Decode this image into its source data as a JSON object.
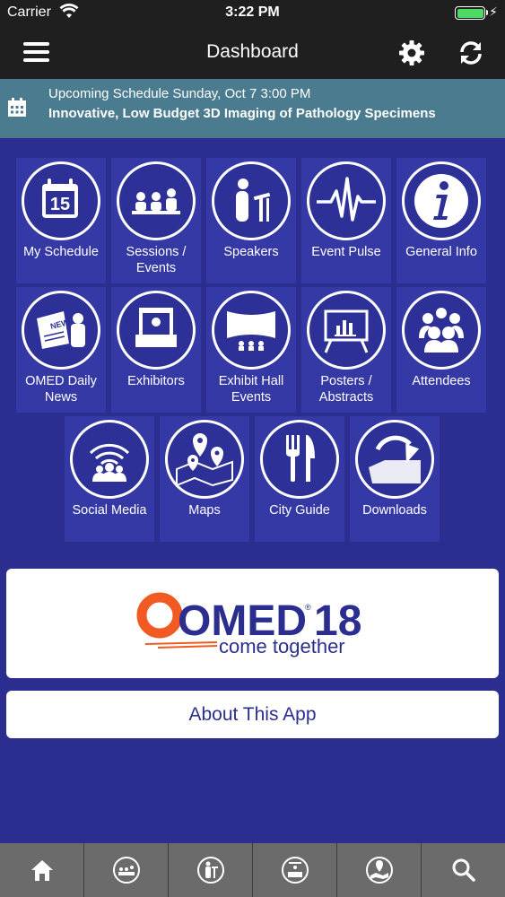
{
  "status_bar": {
    "carrier": "Carrier",
    "time": "3:22 PM",
    "battery_color": "#4cd964"
  },
  "navbar": {
    "title": "Dashboard",
    "left_icon": "hamburger-menu-icon",
    "right_icons": [
      "gear-icon",
      "refresh-icon"
    ]
  },
  "banner": {
    "icon": "calendar-icon",
    "line1": "Upcoming Schedule Sunday, Oct 7 3:00 PM",
    "line2": "Innovative, Low Budget 3D Imaging of Pathology Specimens"
  },
  "tiles": [
    {
      "label": "My Schedule",
      "icon": "calendar-15-icon"
    },
    {
      "label": "Sessions / Events",
      "icon": "audience-icon"
    },
    {
      "label": "Speakers",
      "icon": "speaker-podium-icon"
    },
    {
      "label": "Event Pulse",
      "icon": "pulse-icon"
    },
    {
      "label": "General Info",
      "icon": "info-icon"
    },
    {
      "label": "OMED Daily News",
      "icon": "newspaper-icon"
    },
    {
      "label": "Exhibitors",
      "icon": "exhibitor-booth-icon"
    },
    {
      "label": "Exhibit Hall Events",
      "icon": "exhibit-hall-icon"
    },
    {
      "label": "Posters / Abstracts",
      "icon": "poster-board-icon"
    },
    {
      "label": "Attendees",
      "icon": "attendees-icon"
    },
    {
      "label": "Social Media",
      "icon": "social-broadcast-icon"
    },
    {
      "label": "Maps",
      "icon": "map-pins-icon"
    },
    {
      "label": "City Guide",
      "icon": "fork-knife-icon"
    },
    {
      "label": "Downloads",
      "icon": "download-icon"
    }
  ],
  "logo": {
    "brand": "OMED",
    "year": "18",
    "tagline": "come together",
    "brand_color": "#2b2e8f",
    "accent_color": "#f15a22"
  },
  "about_button": "About This App",
  "tabbar": {
    "tabs": [
      "home-icon",
      "sessions-icon",
      "speakers-icon",
      "exhibitors-icon",
      "maps-icon",
      "search-icon"
    ]
  },
  "colors": {
    "background": "#2b2e8f",
    "tile": "#3439a6",
    "banner": "#4a7b8e",
    "topbar": "#1f1f1f",
    "tabbar": "#6b6b6b"
  }
}
